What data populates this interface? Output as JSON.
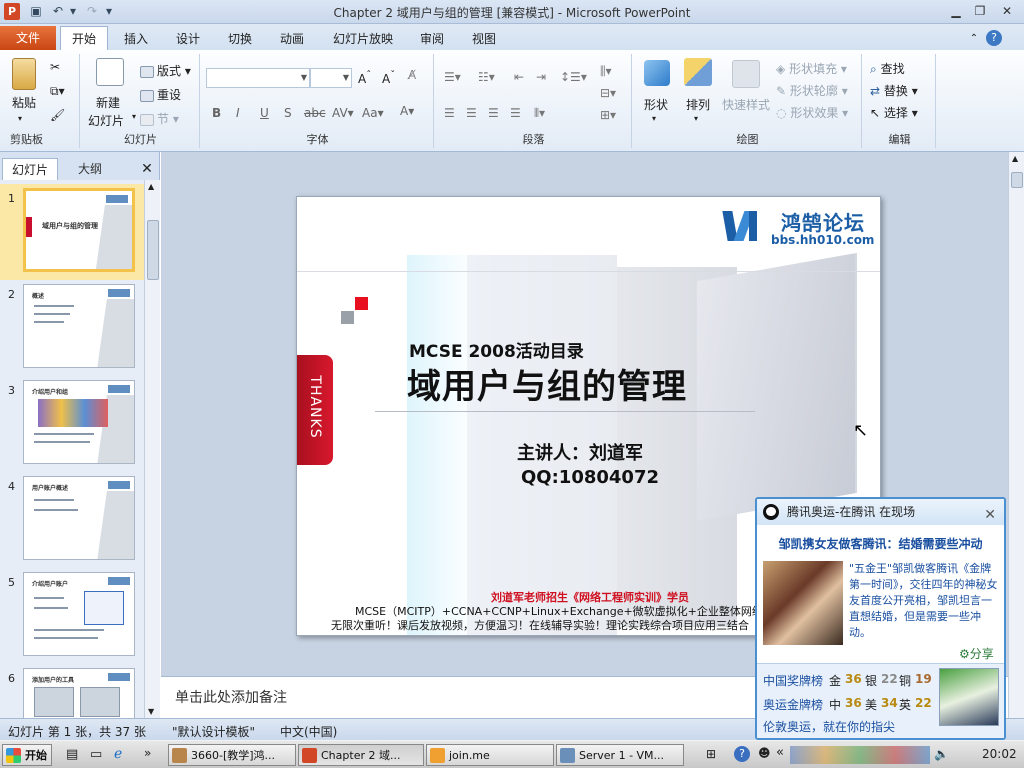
{
  "window": {
    "title": "Chapter 2 域用户与组的管理 [兼容模式] - Microsoft PowerPoint",
    "app_icon": "P"
  },
  "tabs": [
    "文件",
    "开始",
    "插入",
    "设计",
    "切换",
    "动画",
    "幻灯片放映",
    "审阅",
    "视图"
  ],
  "ribbon": {
    "clipboard": {
      "label": "剪贴板",
      "paste": "粘贴"
    },
    "slides": {
      "label": "幻灯片",
      "new": "新建",
      "new2": "幻灯片",
      "layout": "版式",
      "reset": "重设",
      "section": "节"
    },
    "font": {
      "label": "字体"
    },
    "paragraph": {
      "label": "段落"
    },
    "drawing": {
      "label": "绘图",
      "shape": "形状",
      "arrange": "排列",
      "quickstyle": "快速样式",
      "fill": "形状填充",
      "outline": "形状轮廓",
      "effect": "形状效果"
    },
    "editing": {
      "label": "编辑",
      "find": "查找",
      "replace": "替换",
      "select": "选择"
    }
  },
  "leftpane": {
    "tab_slides": "幻灯片",
    "tab_outline": "大纲",
    "close": "✕"
  },
  "thumbs": [
    {
      "num": "1",
      "title": "域用户与组的管理",
      "selected": true
    },
    {
      "num": "2",
      "title": "概述"
    },
    {
      "num": "3",
      "title": "介绍用户和组"
    },
    {
      "num": "4",
      "title": "用户账户概述"
    },
    {
      "num": "5",
      "title": "介绍用户账户"
    },
    {
      "num": "6",
      "title": "添加用户的工具"
    }
  ],
  "slide": {
    "logo_cn": "鸿鹄论坛",
    "logo_url": "bbs.hh010.com",
    "thanks": "THANKS",
    "subtitle": "MCSE 2008活动目录",
    "title": "域用户与组的管理",
    "presenter": "主讲人：刘道军",
    "qq": "QQ:10804072",
    "ad_line1": "刘道军老师招生《网络工程师实训》学员",
    "ad_line2": "MCSE（MCITP）+CCNA+CCNP+Linux+Exchange+微软虚拟化+企业整体网络",
    "ad_line3": "无限次重听！课后发放视频，方便温习！在线辅导实验！理论实践综合项目应用三结合"
  },
  "notes": "单击此处添加备注",
  "status": {
    "slide": "幻灯片 第 1 张，共 37 张",
    "theme": "\"默认设计模板\"",
    "lang": "中文(中国)"
  },
  "taskbar": {
    "start": "开始",
    "items": [
      "3660-[教学]鸿...",
      "Chapter 2 域...",
      "join.me",
      "Server 1 - VM..."
    ],
    "clock": "20:02"
  },
  "popup": {
    "header": "腾讯奥运-在腾讯 在现场",
    "headline": "邹凯携女友做客腾讯：结婚需要些冲动",
    "body": "\"五金王\"邹凯做客腾讯《金牌第一时间》，交往四年的神秘女友首度公开亮相，邹凯坦言一直想结婚，但是需要一些冲动。",
    "share": "分享",
    "board1": "中国奖牌榜",
    "g1": "金",
    "g1v": "36",
    "s1": "银",
    "s1v": "22",
    "b1": "铜",
    "b1v": "19",
    "board2": "奥运金牌榜",
    "c1": "中",
    "c1v": "36",
    "c2": "美",
    "c2v": "34",
    "c3": "英",
    "c3v": "22",
    "footer": "伦敦奥运，就在你的指尖"
  },
  "colors": {
    "accent": "#c94613",
    "brand": "#1c5ea6",
    "red": "#c8102e"
  }
}
